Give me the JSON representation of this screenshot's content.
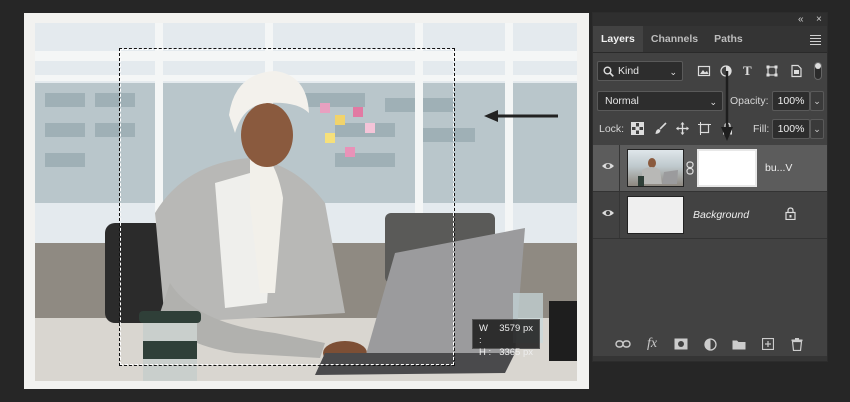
{
  "dimensions": {
    "w_label": "W :",
    "w_value": "3579 px",
    "h_label": "H :",
    "h_value": "3365 px"
  },
  "panel": {
    "collapse_glyph": "«",
    "close_glyph": "×",
    "tabs": [
      {
        "label": "Layers"
      },
      {
        "label": "Channels"
      },
      {
        "label": "Paths"
      }
    ],
    "filter": {
      "kind_label": "Kind",
      "icons": [
        "image-filter-icon",
        "adjustment-filter-icon",
        "type-filter-icon",
        "shape-filter-icon",
        "smart-object-filter-icon"
      ],
      "type_glyph": "T"
    },
    "blend_mode": "Normal",
    "opacity_label": "Opacity:",
    "opacity_value": "100%",
    "lock_label": "Lock:",
    "fill_label": "Fill:",
    "fill_value": "100%",
    "chevron": "⌄",
    "layers": [
      {
        "name": "bu...V",
        "selected": true
      },
      {
        "name": "Background",
        "selected": false
      }
    ],
    "bottom_icons": [
      "link-layers-icon",
      "fx-icon",
      "add-mask-icon",
      "adjustment-layer-icon",
      "new-group-icon",
      "new-layer-icon",
      "trash-icon"
    ],
    "fx_label": "fx"
  },
  "colors": {
    "panel_bg": "#424242",
    "app_bg": "#262626",
    "selected_layer": "#5c5c5c"
  }
}
